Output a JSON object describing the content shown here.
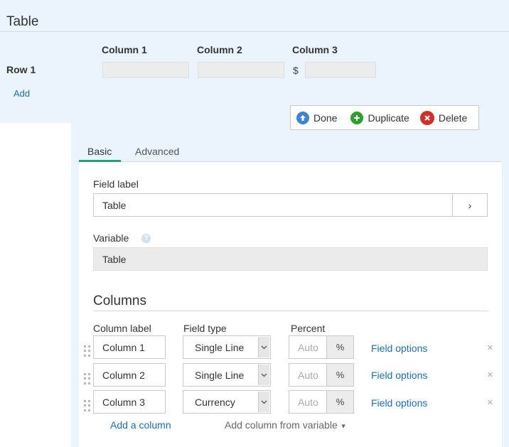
{
  "preview": {
    "title": "Table",
    "column_headers": [
      "Column 1",
      "Column 2",
      "Column 3"
    ],
    "row_label": "Row 1",
    "currency_symbol": "$",
    "add_link": "Add"
  },
  "actions": {
    "done": "Done",
    "duplicate": "Duplicate",
    "delete": "Delete",
    "colors": {
      "done": "#3a86cf",
      "duplicate": "#2ca02c",
      "delete": "#d0302a"
    }
  },
  "tabs": [
    {
      "label": "Basic",
      "active": true
    },
    {
      "label": "Advanced",
      "active": false
    }
  ],
  "accent_color": "#2a9d7d",
  "field_label": {
    "label": "Field label",
    "value": "Table",
    "button": "›"
  },
  "variable": {
    "label": "Variable",
    "value": "Table",
    "help_icon": "question-circle-icon"
  },
  "columns_section": {
    "title": "Columns",
    "headers": {
      "column_label": "Column label",
      "field_type": "Field type",
      "percent": "Percent"
    },
    "rows": [
      {
        "label": "Column 1",
        "type": "Single Line",
        "percent_placeholder": "Auto",
        "percent_unit": "%",
        "options": "Field options",
        "remove": "×"
      },
      {
        "label": "Column 2",
        "type": "Single Line",
        "percent_placeholder": "Auto",
        "percent_unit": "%",
        "options": "Field options",
        "remove": "×"
      },
      {
        "label": "Column 3",
        "type": "Currency",
        "percent_placeholder": "Auto",
        "percent_unit": "%",
        "options": "Field options",
        "remove": "×"
      }
    ],
    "add_column": "Add a column",
    "add_from_variable": "Add column from variable"
  }
}
